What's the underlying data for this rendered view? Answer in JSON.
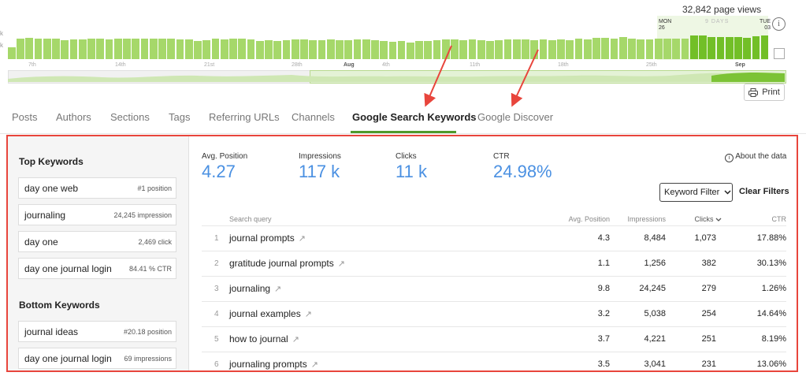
{
  "timeline": {
    "total_views": "32,842 page views",
    "axis_labels": [
      "k",
      "k"
    ],
    "ticks": [
      "7th",
      "14th",
      "21st",
      "28th",
      "Aug",
      "4th",
      "11th",
      "18th",
      "25th",
      "Sep"
    ],
    "start_day": "MON",
    "start_date": "26",
    "end_day": "TUE",
    "end_date": "03",
    "span": "9 DAYS",
    "bar_levels": [
      0.5,
      0.88,
      0.9,
      0.88,
      0.86,
      0.88,
      0.8,
      0.82,
      0.84,
      0.88,
      0.86,
      0.84,
      0.88,
      0.88,
      0.86,
      0.88,
      0.86,
      0.86,
      0.86,
      0.84,
      0.82,
      0.78,
      0.8,
      0.86,
      0.84,
      0.86,
      0.86,
      0.84,
      0.78,
      0.8,
      0.78,
      0.8,
      0.82,
      0.82,
      0.8,
      0.8,
      0.82,
      0.8,
      0.8,
      0.84,
      0.82,
      0.8,
      0.76,
      0.72,
      0.78,
      0.7,
      0.76,
      0.76,
      0.8,
      0.82,
      0.84,
      0.8,
      0.82,
      0.8,
      0.78,
      0.8,
      0.82,
      0.82,
      0.84,
      0.8,
      0.82,
      0.8,
      0.82,
      0.8,
      0.86,
      0.82,
      0.9,
      0.9,
      0.88,
      0.92,
      0.86,
      0.84,
      0.82,
      0.86,
      0.86,
      0.86,
      0.86,
      1.0,
      1.0,
      0.92,
      0.94,
      0.92,
      0.94,
      0.9,
      0.96,
      1.0
    ],
    "highlight_from": 77,
    "colors": {
      "bar": "#a6d86a",
      "highlight": "#72bf27",
      "annotation": "#e8453c"
    }
  },
  "print_label": "Print",
  "tabs": [
    "Posts",
    "Authors",
    "Sections",
    "Tags",
    "Referring URLs",
    "Channels",
    "Google Search Keywords",
    "Google Discover"
  ],
  "active_tab": "Google Search Keywords",
  "side": {
    "top_title": "Top Keywords",
    "top": [
      {
        "name": "day one web",
        "stat": "#1 position"
      },
      {
        "name": "journaling",
        "stat": "24,245 impression"
      },
      {
        "name": "day one",
        "stat": "2,469 click"
      },
      {
        "name": "day one journal login",
        "stat": "84.41 % CTR"
      }
    ],
    "bottom_title": "Bottom Keywords",
    "bottom": [
      {
        "name": "journal ideas",
        "stat": "#20.18 position"
      },
      {
        "name": "day one journal login",
        "stat": "69 impressions"
      }
    ]
  },
  "summary": {
    "avg_position": {
      "label": "Avg. Position",
      "value": "4.27"
    },
    "impressions": {
      "label": "Impressions",
      "value": "117 k"
    },
    "clicks": {
      "label": "Clicks",
      "value": "11 k"
    },
    "ctr": {
      "label": "CTR",
      "value": "24.98%"
    },
    "about": "About the data",
    "value_color": "#4a90e2"
  },
  "filter": {
    "label": "Keyword Filter",
    "clear": "Clear Filters"
  },
  "table": {
    "headers": {
      "query": "Search query",
      "position": "Avg. Position",
      "impressions": "Impressions",
      "clicks": "Clicks",
      "ctr": "CTR"
    },
    "rows": [
      {
        "n": "1",
        "query": "journal prompts",
        "position": "4.3",
        "impressions": "8,484",
        "clicks": "1,073",
        "ctr": "17.88%"
      },
      {
        "n": "2",
        "query": "gratitude journal prompts",
        "position": "1.1",
        "impressions": "1,256",
        "clicks": "382",
        "ctr": "30.13%"
      },
      {
        "n": "3",
        "query": "journaling",
        "position": "9.8",
        "impressions": "24,245",
        "clicks": "279",
        "ctr": "1.26%"
      },
      {
        "n": "4",
        "query": "journal examples",
        "position": "3.2",
        "impressions": "5,038",
        "clicks": "254",
        "ctr": "14.64%"
      },
      {
        "n": "5",
        "query": "how to journal",
        "position": "3.7",
        "impressions": "4,221",
        "clicks": "251",
        "ctr": "8.19%"
      },
      {
        "n": "6",
        "query": "journaling prompts",
        "position": "3.5",
        "impressions": "3,041",
        "clicks": "231",
        "ctr": "13.06%"
      }
    ]
  }
}
